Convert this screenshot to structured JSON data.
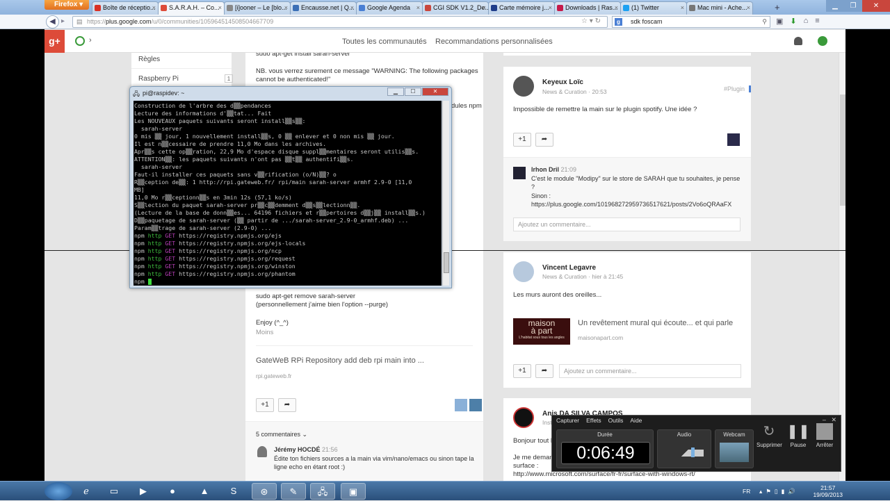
{
  "browser": {
    "firefox_label": "Firefox",
    "tabs": [
      {
        "label": "Boîte de réceptio...",
        "color": "#d93025"
      },
      {
        "label": "S.A.R.A.H. – Co...",
        "color": "#dd4b39",
        "active": true
      },
      {
        "label": "[i]ooner – Le [blo...",
        "color": "#888888"
      },
      {
        "label": "Encausse.net | Q...",
        "color": "#3b6fb6"
      },
      {
        "label": "Google Agenda",
        "color": "#4a7fd4"
      },
      {
        "label": "CGI SDK V1.2_De...",
        "color": "#c9463d"
      },
      {
        "label": "Carte mémoire j...",
        "color": "#1f3d8a"
      },
      {
        "label": "Downloads | Ras...",
        "color": "#c51a4a"
      },
      {
        "label": "(1) Twitter",
        "color": "#1da1f2"
      },
      {
        "label": "Mac mini - Ache...",
        "color": "#777777"
      }
    ],
    "new_tab": "+",
    "url_prefix": "https://",
    "url_domain": "plus.google.com",
    "url_path": "/u/0/communities/105964514508504667709",
    "search_value": "sdk foscam"
  },
  "gplus": {
    "logo": "g+",
    "nav_all": "Toutes les communautés",
    "nav_reco": "Recommandations personnalisées"
  },
  "left_sidebar": {
    "items": [
      {
        "label": "Règles"
      },
      {
        "label": "Raspberry Pi",
        "count": "1"
      }
    ]
  },
  "middle_post": {
    "line_install": "sudo apt-get install sarah-server",
    "nb_line1": "NB. vous verrez surement ce message \"WARNING: The following packages",
    "nb_line2": "cannot be authenticated!\"",
    "hidden_tail": "dules npm",
    "remove_line": "sudo apt-get remove sarah-server",
    "purge_line": "(personnellement j'aime bien l'option --purge)",
    "enjoy": "Enjoy (^_^)",
    "less": "Moins",
    "link_title": "GateWeB RPi Repository add deb rpi main into ...",
    "link_domain": "rpi.gateweb.fr",
    "plus_one": "+1",
    "share": "➦",
    "comments_count": "5 commentaires",
    "comment_author": "Jérémy HOCDÉ",
    "comment_time": "21:56",
    "comment_line1": "Édite ton fichiers sources a la main via vim/nano/emacs ou sinon tape la",
    "comment_line2": "ligne echo en étant root :)"
  },
  "right_posts": {
    "post1": {
      "author": "Keyeux Loïc",
      "meta": "News & Curation  ·  20:53",
      "tag": "#Plugin",
      "body": "Impossible de remettre la main sur le plugin spotify. Une idée ?",
      "plus_one": "+1",
      "reply_author": "Irhon Dril",
      "reply_time": "21:09",
      "reply_line1": "C'est le module \"Modipy\" sur le store de SARAH que tu souhaites, je pense",
      "reply_line2": "?",
      "reply_line3": "Sinon :",
      "reply_line4": "https://plus.google.com/101968272959736517621/posts/2Vo6oQRAaFX",
      "comment_placeholder": "Ajoutez un commentaire..."
    },
    "post2": {
      "author": "Vincent Legavre",
      "meta": "News & Curation  ·  hier à 21:45",
      "body": "Les murs auront des oreilles...",
      "link_logo_line1": "maison",
      "link_logo_line2": "à part",
      "link_logo_tagline": "L'habitat sous tous les angles",
      "link_title": "Un revêtement mural qui écoute... et qui parle",
      "link_domain": "maisonapart.com",
      "plus_one": "+1",
      "comment_placeholder": "Ajoutez un commentaire..."
    },
    "post3": {
      "author": "Anis DA SILVA CAMPOS",
      "meta": "Inst",
      "line1": "Bonjour tout l",
      "line2": "Je me demand",
      "line3": "surface :",
      "line4": "http://www.microsoft.com/surface/fr-fr/surface-with-windows-rt/"
    }
  },
  "putty": {
    "title": "pi@raspidev: ~",
    "lines": [
      [
        {
          "t": "Construction de l'arbre des d▒▒pendances"
        }
      ],
      [
        {
          "t": "Lecture des informations d'▒▒tat... Fait"
        }
      ],
      [
        {
          "t": "Les NOUVEAUX paquets suivants seront install▒▒s▒▒:"
        }
      ],
      [
        {
          "t": "  sarah-server"
        }
      ],
      [
        {
          "t": "0 mis ▒▒ jour, 1 nouvellement install▒▒s, 0 ▒▒ enlever et 0 non mis ▒▒ jour."
        }
      ],
      [
        {
          "t": "Il est n▒▒cessaire de prendre 11,0 Mo dans les archives."
        }
      ],
      [
        {
          "t": "Apr▒▒s cette op▒▒ration, 22,9 Mo d'espace disque suppl▒▒mentaires seront utilis▒▒s."
        }
      ],
      [
        {
          "t": "ATTENTION▒▒: les paquets suivants n'ont pas ▒▒t▒▒ authentifi▒▒s."
        }
      ],
      [
        {
          "t": "  sarah-server"
        }
      ],
      [
        {
          "t": "Faut-il installer ces paquets sans v▒▒rification (o/N)▒▒? o"
        }
      ],
      [
        {
          "t": "R▒▒ception de▒▒: 1 http://rpi.gateweb.fr/ rpi/main sarah-server armhf 2.9-0 [11,0"
        }
      ],
      [
        {
          "t": "MB]"
        }
      ],
      [
        {
          "t": "11,0 Mo r▒▒ceptionn▒▒s en 3min 12s (57,1 ko/s)"
        }
      ],
      [
        {
          "t": "S▒▒lection du paquet sarah-server pr▒▒c▒▒demment d▒▒s▒▒lectionn▒▒."
        }
      ],
      [
        {
          "t": "(Lecture de la base de donn▒▒es... 64196 fichiers et r▒▒pertoires d▒▒j▒▒ install▒▒s.)"
        }
      ],
      [
        {
          "t": "D▒▒paquetage de sarah-server (▒▒ partir de .../sarah-server_2.9-0_armhf.deb) ..."
        }
      ],
      [
        {
          "t": "Param▒▒trage de sarah-server (2.9-0) ..."
        }
      ],
      [
        {
          "t": "npm "
        },
        {
          "t": "http ",
          "c": "g"
        },
        {
          "t": "GET ",
          "c": "m"
        },
        {
          "t": "https://registry.npmjs.org/ejs"
        }
      ],
      [
        {
          "t": "npm "
        },
        {
          "t": "http ",
          "c": "g"
        },
        {
          "t": "GET ",
          "c": "m"
        },
        {
          "t": "https://registry.npmjs.org/ejs-locals"
        }
      ],
      [
        {
          "t": "npm "
        },
        {
          "t": "http ",
          "c": "g"
        },
        {
          "t": "GET ",
          "c": "m"
        },
        {
          "t": "https://registry.npmjs.org/ncp"
        }
      ],
      [
        {
          "t": "npm "
        },
        {
          "t": "http ",
          "c": "g"
        },
        {
          "t": "GET ",
          "c": "m"
        },
        {
          "t": "https://registry.npmjs.org/request"
        }
      ],
      [
        {
          "t": "npm "
        },
        {
          "t": "http ",
          "c": "g"
        },
        {
          "t": "GET ",
          "c": "m"
        },
        {
          "t": "https://registry.npmjs.org/winston"
        }
      ],
      [
        {
          "t": "npm "
        },
        {
          "t": "http ",
          "c": "g"
        },
        {
          "t": "GET ",
          "c": "m"
        },
        {
          "t": "https://registry.npmjs.org/phantom"
        }
      ],
      [
        {
          "t": "npm "
        }
      ]
    ]
  },
  "recorder": {
    "menu": [
      "Capturer",
      "Effets",
      "Outils",
      "Aide"
    ],
    "duration_label": "Durée",
    "duration": "0:06:49",
    "audio_label": "Audio",
    "webcam_label": "Webcam",
    "delete_label": "Supprimer",
    "pause_label": "Pause",
    "stop_label": "Arrêter"
  },
  "taskbar": {
    "lang": "FR",
    "time": "21:57",
    "date": "19/09/2013"
  }
}
